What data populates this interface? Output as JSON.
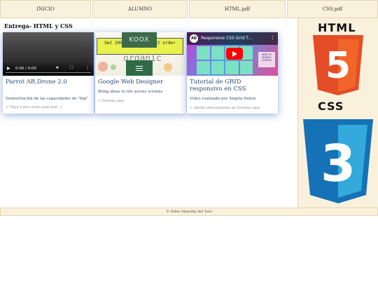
{
  "nav": {
    "items": [
      {
        "label": "INICIO"
      },
      {
        "label": "ALUMNO"
      },
      {
        "label": "HTML.pdf"
      },
      {
        "label": "CSS.pdf"
      }
    ]
  },
  "page": {
    "title": "Entrega- HTML y CSS"
  },
  "cards": [
    {
      "title": "Parrot AR.Drone 2.0",
      "description": "Demostración de las capacidades de \"flip\"",
      "link": "> Vlips a otro nivel (sale mal...)",
      "video": {
        "time": "0:00 / 0:00"
      }
    },
    {
      "title": "Google Web Designer",
      "description": "Bring ideas to life across screens",
      "link": "> Visitala aqui",
      "promo_text": "Get 20% off your first order",
      "brand": "KOOX",
      "organic_text": "organic"
    },
    {
      "title": "Tutorial de GRID responsivo en CSS",
      "description": "Video realizado por Angela Delise",
      "link": "> Ahrelo directamente en Youtube aqui",
      "video_title": "Responsive CSS Grid T...",
      "channel_initials": "AD",
      "side_text": "WEB TO MOBILE DESIGN"
    }
  ],
  "sidebar": {
    "html_label": "HTML",
    "html_number": "5",
    "css_label": "CSS",
    "css_number": "3",
    "colors": {
      "html": "#e44d26",
      "html_light": "#f16529",
      "css": "#1572b6",
      "css_light": "#33a9dc"
    }
  },
  "footer": {
    "text": "© Pablo Mansilla del Toro"
  },
  "icons": {
    "play": "play-icon",
    "volume": "volume-icon",
    "fullscreen": "fullscreen-icon",
    "more": "more-vertical-icon",
    "menu": "hamburger-icon"
  }
}
